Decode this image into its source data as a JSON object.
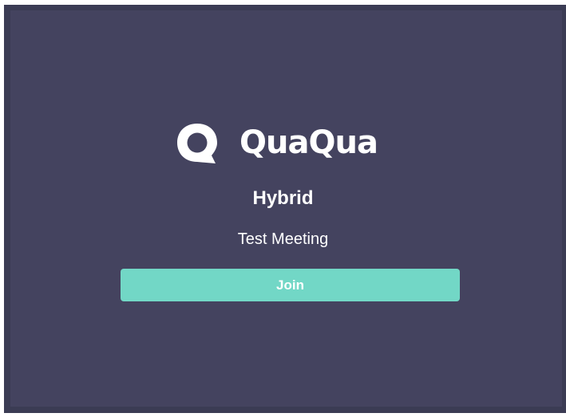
{
  "brand": {
    "name": "QuaQua",
    "icon": "quaqua-speech-bubble-icon"
  },
  "space": {
    "name": "Hybrid"
  },
  "meeting": {
    "name": "Test Meeting"
  },
  "actions": {
    "join_label": "Join"
  },
  "colors": {
    "background": "#44435f",
    "frame": "#3b3c54",
    "accent": "#72d7c6",
    "text": "#ffffff"
  }
}
